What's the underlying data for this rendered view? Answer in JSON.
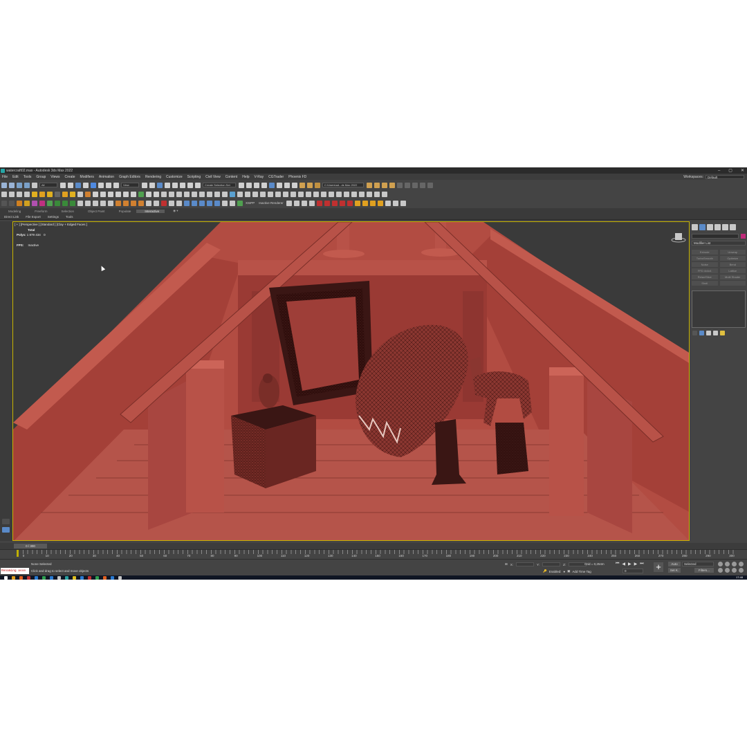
{
  "window": {
    "title": "watercraft02.max - Autodesk 3ds Max 2022",
    "buttons": [
      "–",
      "▢",
      "✕"
    ]
  },
  "menu": [
    "File",
    "Edit",
    "Tools",
    "Group",
    "Views",
    "Create",
    "Modifiers",
    "Animation",
    "Graph Editors",
    "Rendering",
    "Customize",
    "Scripting",
    "Civil View",
    "Content",
    "Help",
    "V-Ray",
    "CGTrader",
    "Phoenix FD"
  ],
  "workspace": {
    "label": "Workspaces:",
    "value": "Default"
  },
  "toolbar": {
    "filter": "All",
    "refcoord": "View",
    "selection_set": "Create Selection Set",
    "project_path": "C:\\Users\\ad...ds Max 2022",
    "xsinfo": "XSIPP",
    "renderer": "Inactive Renderer"
  },
  "ribbon": {
    "tabs": [
      "Modeling",
      "Freeform",
      "Selection",
      "Object Paint",
      "Populate",
      "Interactive"
    ],
    "active": "Interactive",
    "subtabs": [
      "Direct Link",
      "File Export",
      "Settings",
      "Tools"
    ]
  },
  "viewport": {
    "label": "[ + ] [Perspective ] [Standard ] [Clay + Edged Faces ]",
    "stats_title": "Total",
    "polys_label": "Polys:",
    "polys_value": "1 879 434",
    "polys_sel": "0",
    "fps_label": "FPS:",
    "fps_value": "Inactive"
  },
  "command_panel": {
    "modifier_list": "Modifier List",
    "buttons": [
      "Extrude",
      "Unwrap",
      "TurboSmooth",
      "Optimize",
      "Noise",
      "Bend",
      "FFD 4x4x4",
      "Lattice",
      "Relax/Slice",
      "Multi Shader",
      "Shell",
      ""
    ],
    "name_color": "#c02a7a"
  },
  "timeline": {
    "frame": "0 / 300",
    "ticks": [
      "0",
      "10",
      "20",
      "30",
      "40",
      "50",
      "60",
      "70",
      "80",
      "90",
      "100",
      "110",
      "120",
      "130",
      "140",
      "150",
      "160",
      "170",
      "180",
      "190",
      "200",
      "210",
      "220",
      "230",
      "240",
      "250",
      "260",
      "270",
      "280",
      "290",
      "300"
    ]
  },
  "status": {
    "maxscript": "Renaming asse",
    "selection": "None Selected",
    "prompt": "Click and drag to select and move objects",
    "x_label": "X:",
    "y_label": "Y:",
    "z_label": "Z:",
    "grid": "Grid = 0,254m",
    "enabled": "Enabled:",
    "add_time_tag": "Add Time Tag",
    "frame_value": "0",
    "auto": "Auto",
    "set_k": "Set K.",
    "selected": "Selected",
    "filters": "Filters..."
  },
  "taskbar": {
    "clock": "17:48"
  },
  "colors": {
    "viewport_bg": "#8a3a32",
    "clay": "#b8564a",
    "active_border": "#c8b400"
  }
}
